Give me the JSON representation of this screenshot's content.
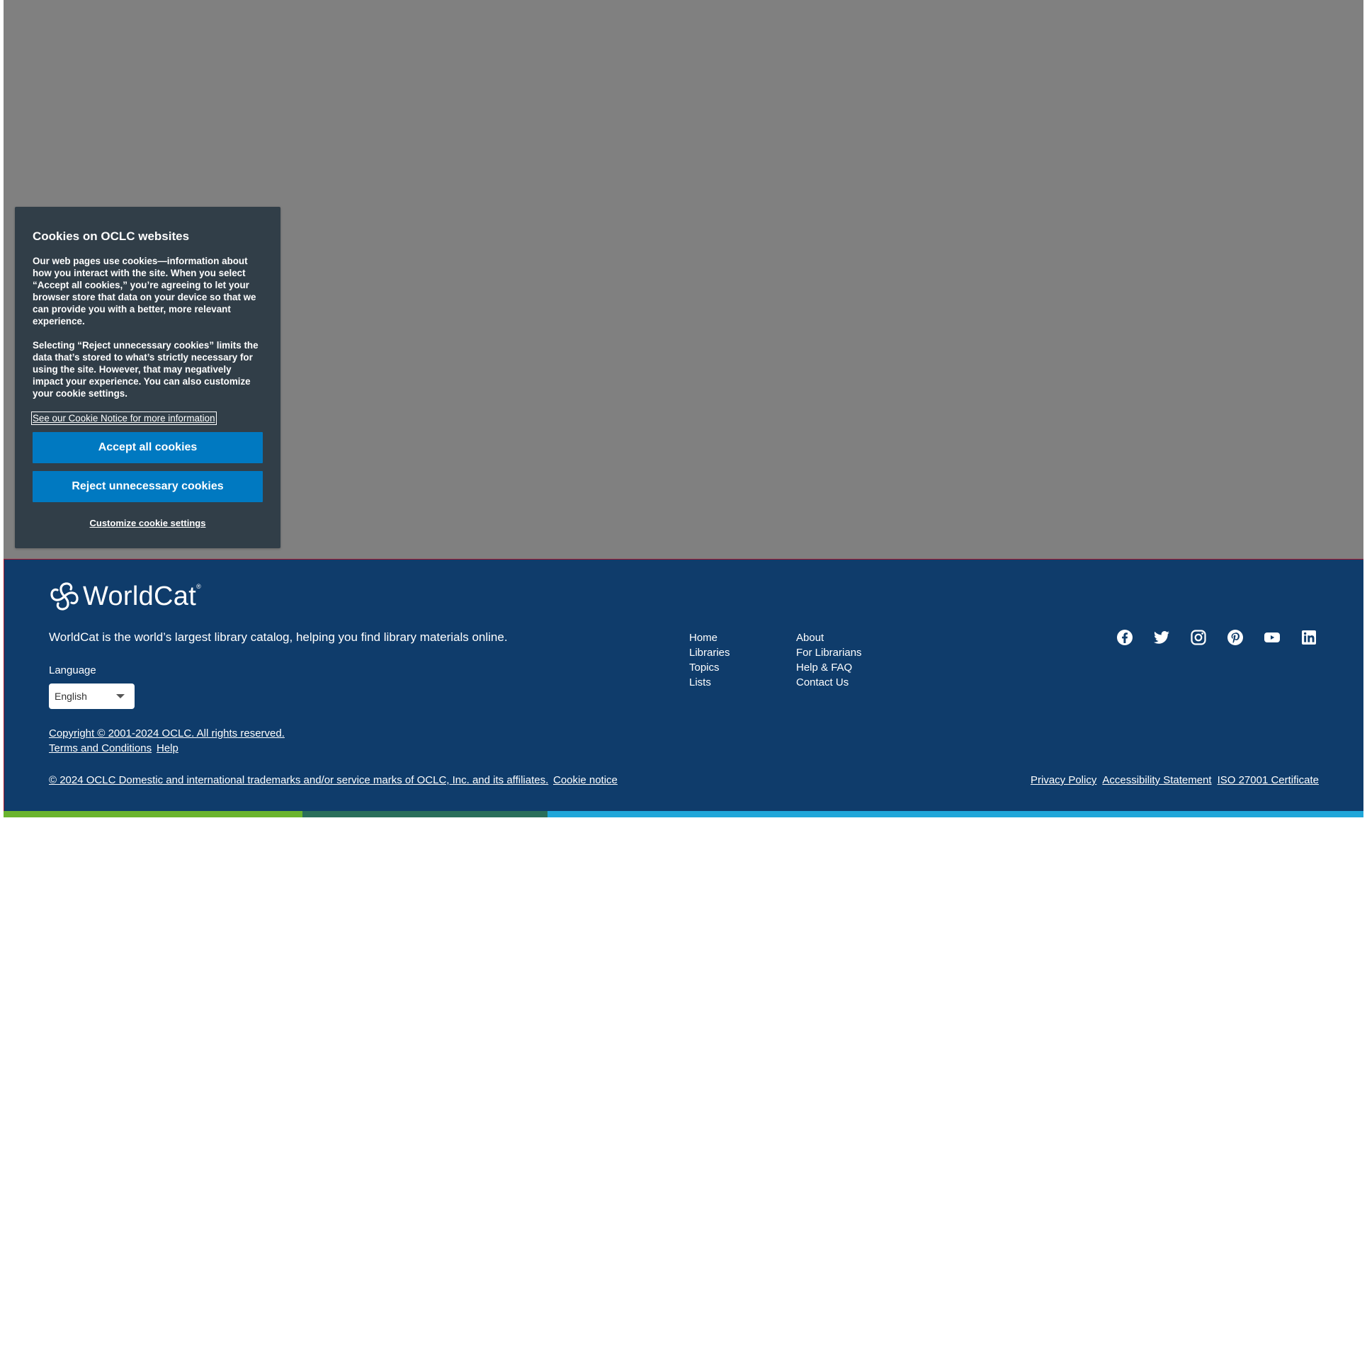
{
  "cookie_banner": {
    "title": "Cookies on OCLC websites",
    "paragraph_1": "Our web pages use cookies—information about how you interact with the site. When you select “Accept all cookies,” you’re agreeing to let your browser store that data on your device so that we can provide you with a better, more relevant experience.",
    "paragraph_2": "Selecting “Reject unnecessary cookies” limits the data that’s stored to what’s strictly necessary for using the site. However, that may negatively impact your experience. You can also customize your cookie settings.",
    "notice_link": "See our Cookie Notice for more information",
    "accept_label": "Accept all cookies",
    "reject_label": "Reject unnecessary cookies",
    "customize_label": "Customize cookie settings",
    "accent_color": "#0079c1"
  },
  "footer": {
    "logo_text": "WorldCat",
    "logo_mark": "®",
    "tagline": "WorldCat is the world’s largest library catalog, helping you find library materials online.",
    "language_label": "Language",
    "language_value": "English",
    "nav_col_1": [
      "Home",
      "Libraries",
      "Topics",
      "Lists"
    ],
    "nav_col_2": [
      "About",
      "For Librarians",
      "Help & FAQ",
      "Contact Us"
    ],
    "social_icons": [
      "facebook-icon",
      "twitter-icon",
      "instagram-icon",
      "pinterest-icon",
      "youtube-icon",
      "linkedin-icon"
    ],
    "copyright": "Copyright © 2001-2024 OCLC. All rights reserved.",
    "terms": "Terms and Conditions",
    "help": "Help",
    "trademarks": "© 2024 OCLC Domestic and international trademarks and/or service marks of OCLC, Inc. and its affiliates.",
    "cookie_notice": "Cookie notice",
    "privacy": "Privacy Policy",
    "accessibility": "Accessibility Statement",
    "iso": "ISO 27001 Certificate",
    "background_color": "#0f3c6b",
    "color_bar": [
      "#6ab42d",
      "#2a6e5a",
      "#1fa6d9"
    ]
  }
}
